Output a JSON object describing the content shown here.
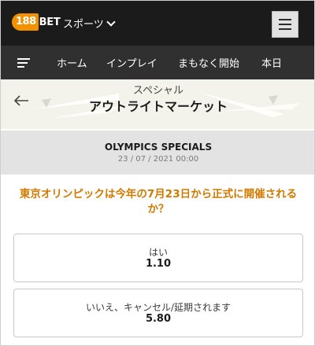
{
  "header": {
    "logo_number": "188",
    "logo_text": "BET",
    "sport_selector": "スポーツ"
  },
  "nav": {
    "items": [
      {
        "label": "ホーム"
      },
      {
        "label": "インプレイ"
      },
      {
        "label": "まもなく開始"
      },
      {
        "label": "本日"
      }
    ]
  },
  "page": {
    "subtitle": "スペシャル",
    "title": "アウトライトマーケット"
  },
  "event": {
    "name": "OLYMPICS SPECIALS",
    "date": "23 / 07 / 2021 00:00"
  },
  "market": {
    "question": "東京オリンピックは今年の7月23日から正式に開催されるか？",
    "options": [
      {
        "label": "はい",
        "odds": "1.10"
      },
      {
        "label": "いいえ、キャンセル/延期されます",
        "odds": "5.80"
      }
    ]
  },
  "colors": {
    "header_bg": "#1b1b1b",
    "nav_bg": "#303030",
    "brand_orange": "#f39200",
    "question_text": "#d17a00",
    "event_bg": "#e3e3e3"
  }
}
